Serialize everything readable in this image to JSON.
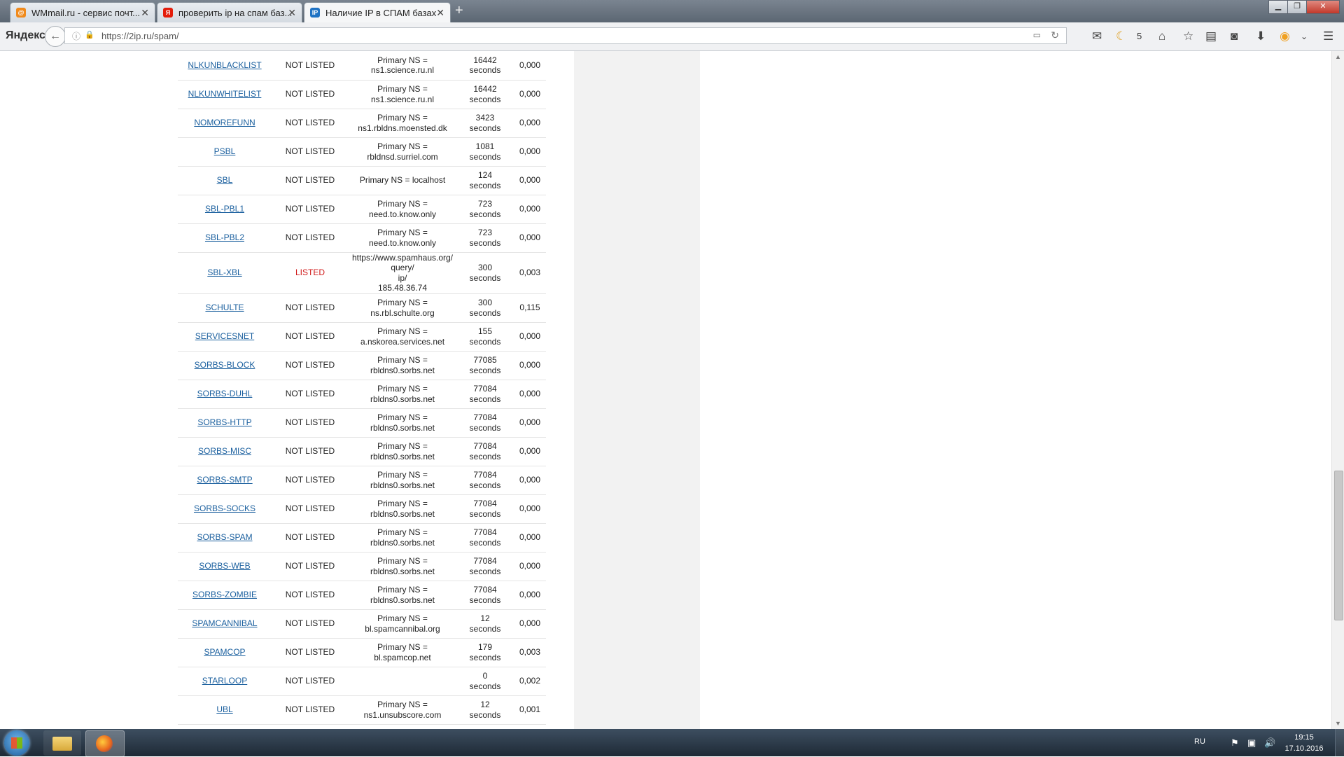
{
  "browser": {
    "tabs": [
      {
        "label": "WMmail.ru - сервис почт...",
        "favicon": "mail-icon"
      },
      {
        "label": "проверить ip на спам баз...",
        "favicon": "yandex-icon"
      },
      {
        "label": "Наличие IP в СПАМ базах",
        "favicon": "2ip-icon"
      }
    ],
    "new_tab": "+",
    "brand": "Яндекс",
    "url": "https://2ip.ru/spam/",
    "weather": "5"
  },
  "table": {
    "rows": [
      {
        "name": "NLKUNBLACKLIST",
        "status": "NOT LISTED",
        "ns": [
          "Primary NS =",
          "ns1.science.ru.nl"
        ],
        "ttl": [
          "16442",
          "seconds"
        ],
        "time": "0,000"
      },
      {
        "name": "NLKUNWHITELIST",
        "status": "NOT LISTED",
        "ns": [
          "Primary NS =",
          "ns1.science.ru.nl"
        ],
        "ttl": [
          "16442",
          "seconds"
        ],
        "time": "0,000"
      },
      {
        "name": "NOMOREFUNN",
        "status": "NOT LISTED",
        "ns": [
          "Primary NS =",
          "ns1.rbldns.moensted.dk"
        ],
        "ttl": [
          "3423",
          "seconds"
        ],
        "time": "0,000"
      },
      {
        "name": "PSBL",
        "status": "NOT LISTED",
        "ns": [
          "Primary NS =",
          "rbldnsd.surriel.com"
        ],
        "ttl": [
          "1081",
          "seconds"
        ],
        "time": "0,000"
      },
      {
        "name": "SBL",
        "status": "NOT LISTED",
        "ns": [
          "Primary NS = localhost"
        ],
        "ttl": [
          "124",
          "seconds"
        ],
        "time": "0,000"
      },
      {
        "name": "SBL-PBL1",
        "status": "NOT LISTED",
        "ns": [
          "Primary NS =",
          "need.to.know.only"
        ],
        "ttl": [
          "723",
          "seconds"
        ],
        "time": "0,000"
      },
      {
        "name": "SBL-PBL2",
        "status": "NOT LISTED",
        "ns": [
          "Primary NS =",
          "need.to.know.only"
        ],
        "ttl": [
          "723",
          "seconds"
        ],
        "time": "0,000"
      },
      {
        "name": "SBL-XBL",
        "status": "LISTED",
        "ns": [
          "https://www.spamhaus.org/",
          "query/",
          "ip/",
          "185.48.36.74"
        ],
        "ttl": [
          "300",
          "seconds"
        ],
        "time": "0,003"
      },
      {
        "name": "SCHULTE",
        "status": "NOT LISTED",
        "ns": [
          "Primary NS =",
          "ns.rbl.schulte.org"
        ],
        "ttl": [
          "300",
          "seconds"
        ],
        "time": "0,115"
      },
      {
        "name": "SERVICESNET",
        "status": "NOT LISTED",
        "ns": [
          "Primary NS =",
          "a.nskorea.services.net"
        ],
        "ttl": [
          "155",
          "seconds"
        ],
        "time": "0,000"
      },
      {
        "name": "SORBS-BLOCK",
        "status": "NOT LISTED",
        "ns": [
          "Primary NS =",
          "rbldns0.sorbs.net"
        ],
        "ttl": [
          "77085",
          "seconds"
        ],
        "time": "0,000"
      },
      {
        "name": "SORBS-DUHL",
        "status": "NOT LISTED",
        "ns": [
          "Primary NS =",
          "rbldns0.sorbs.net"
        ],
        "ttl": [
          "77084",
          "seconds"
        ],
        "time": "0,000"
      },
      {
        "name": "SORBS-HTTP",
        "status": "NOT LISTED",
        "ns": [
          "Primary NS =",
          "rbldns0.sorbs.net"
        ],
        "ttl": [
          "77084",
          "seconds"
        ],
        "time": "0,000"
      },
      {
        "name": "SORBS-MISC",
        "status": "NOT LISTED",
        "ns": [
          "Primary NS =",
          "rbldns0.sorbs.net"
        ],
        "ttl": [
          "77084",
          "seconds"
        ],
        "time": "0,000"
      },
      {
        "name": "SORBS-SMTP",
        "status": "NOT LISTED",
        "ns": [
          "Primary NS =",
          "rbldns0.sorbs.net"
        ],
        "ttl": [
          "77084",
          "seconds"
        ],
        "time": "0,000"
      },
      {
        "name": "SORBS-SOCKS",
        "status": "NOT LISTED",
        "ns": [
          "Primary NS =",
          "rbldns0.sorbs.net"
        ],
        "ttl": [
          "77084",
          "seconds"
        ],
        "time": "0,000"
      },
      {
        "name": "SORBS-SPAM",
        "status": "NOT LISTED",
        "ns": [
          "Primary NS =",
          "rbldns0.sorbs.net"
        ],
        "ttl": [
          "77084",
          "seconds"
        ],
        "time": "0,000"
      },
      {
        "name": "SORBS-WEB",
        "status": "NOT LISTED",
        "ns": [
          "Primary NS =",
          "rbldns0.sorbs.net"
        ],
        "ttl": [
          "77084",
          "seconds"
        ],
        "time": "0,000"
      },
      {
        "name": "SORBS-ZOMBIE",
        "status": "NOT LISTED",
        "ns": [
          "Primary NS =",
          "rbldns0.sorbs.net"
        ],
        "ttl": [
          "77084",
          "seconds"
        ],
        "time": "0,000"
      },
      {
        "name": "SPAMCANNIBAL",
        "status": "NOT LISTED",
        "ns": [
          "Primary NS =",
          "bl.spamcannibal.org"
        ],
        "ttl": [
          "12",
          "seconds"
        ],
        "time": "0,000"
      },
      {
        "name": "SPAMCOP",
        "status": "NOT LISTED",
        "ns": [
          "Primary NS =",
          "bl.spamcop.net"
        ],
        "ttl": [
          "179",
          "seconds"
        ],
        "time": "0,003"
      },
      {
        "name": "STARLOOP",
        "status": "NOT LISTED",
        "ns": [],
        "ttl": [
          "0",
          "seconds"
        ],
        "time": "0,002"
      },
      {
        "name": "UBL",
        "status": "NOT LISTED",
        "ns": [
          "Primary NS =",
          "ns1.unsubscore.com"
        ],
        "ttl": [
          "12",
          "seconds"
        ],
        "time": "0,001"
      }
    ]
  },
  "taskbar": {
    "lang": "RU",
    "time": "19:15",
    "date": "17.10.2016"
  },
  "colors": {
    "link": "#1a5f9e",
    "listed": "#d01a1a"
  }
}
